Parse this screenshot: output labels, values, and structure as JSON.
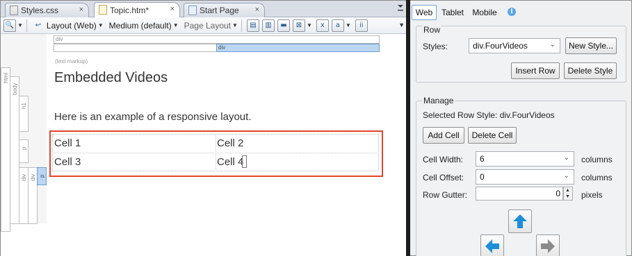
{
  "editor": {
    "tabs": [
      {
        "label": "Styles.css",
        "close": "×"
      },
      {
        "label": "Topic.htm*",
        "close": "×"
      },
      {
        "label": "Start Page",
        "close": "×"
      }
    ],
    "toolbar": {
      "layout_label": "Layout (Web)",
      "medium_label": "Medium (default)",
      "page_layout_label": "Page Layout"
    },
    "structure_bars": {
      "div_top": "div",
      "div_selected": "div",
      "text_markup": "(text markup)",
      "html": "html",
      "body": "body",
      "h1": "h1",
      "p1": "p",
      "div_a": "div",
      "div_b": "div",
      "p2": "p"
    },
    "content": {
      "title": "Embedded Videos",
      "paragraph": "Here is an example of a responsive layout.",
      "cells": [
        "Cell 1",
        "Cell 2",
        "Cell 3",
        "Cell 4"
      ]
    }
  },
  "panel": {
    "tabs": [
      "Web",
      "Tablet",
      "Mobile"
    ],
    "active_tab": "Web",
    "info_icon": "i",
    "row_group": {
      "title": "Row",
      "styles_label": "Styles:",
      "styles_value": "div.FourVideos",
      "new_style_button": "New Style...",
      "insert_row_button": "Insert Row",
      "delete_style_button": "Delete Style"
    },
    "manage_group": {
      "title": "Manage",
      "selected_row_style": "Selected Row Style: div.FourVideos",
      "add_cell_button": "Add Cell",
      "delete_cell_button": "Delete Cell",
      "cell_width_label": "Cell Width:",
      "cell_width_value": "6",
      "cell_width_unit": "columns",
      "cell_offset_label": "Cell Offset:",
      "cell_offset_value": "0",
      "cell_offset_unit": "columns",
      "row_gutter_label": "Row Gutter:",
      "row_gutter_value": "0",
      "row_gutter_unit": "pixels"
    }
  },
  "colors": {
    "selection_frame": "#e0452b",
    "arrow_blue": "#1e8fd6",
    "arrow_gray": "#8a8a8a",
    "selected_div": "#bcd6f2"
  }
}
